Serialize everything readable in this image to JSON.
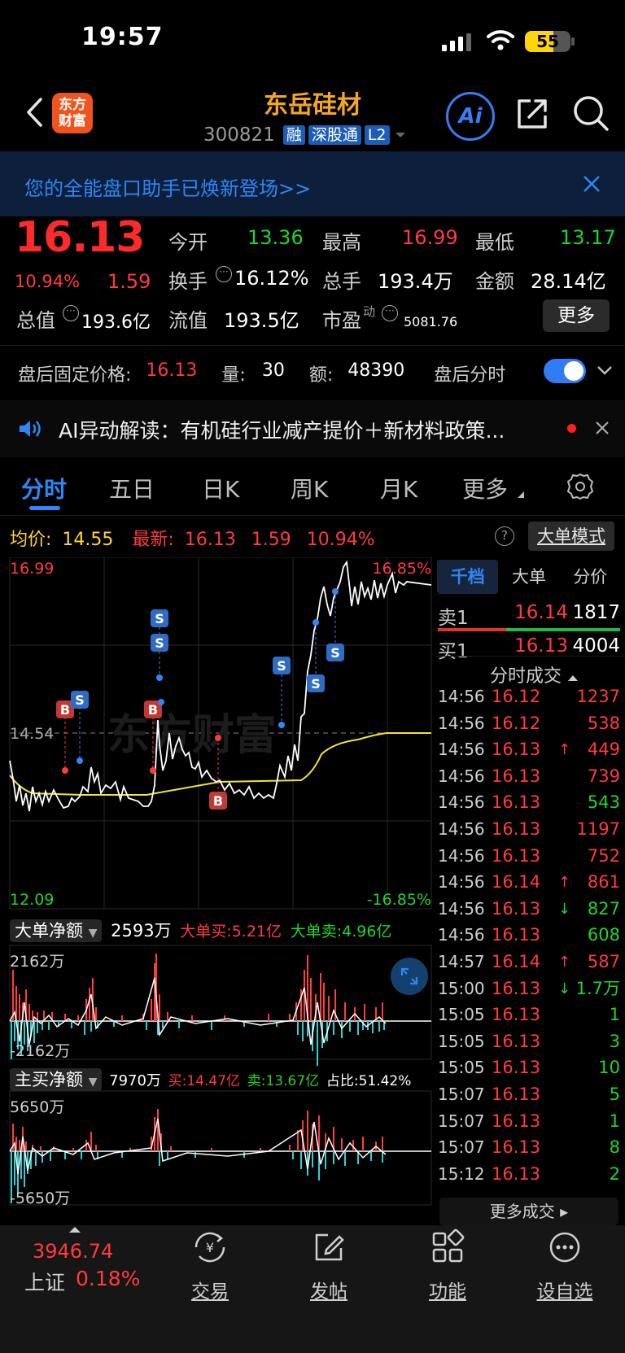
{
  "status_bar": {
    "time": "19:57",
    "battery": "55"
  },
  "header": {
    "logo_line1": "东方",
    "logo_line2": "财富",
    "stock_name": "东岳硅材",
    "stock_code": "300821",
    "tags": [
      "融",
      "深股通",
      "L2"
    ],
    "ai_label": "Ai"
  },
  "banner": {
    "text": "您的全能盘口助手已焕新登场>>"
  },
  "quote": {
    "price": "16.13",
    "change_pct": "10.94%",
    "change": "1.59",
    "open_label": "今开",
    "open": "13.36",
    "high_label": "最高",
    "high": "16.99",
    "low_label": "最低",
    "low": "13.17",
    "turnover_label": "换手",
    "turnover": "16.12%",
    "volume_label": "总手",
    "volume": "193.4万",
    "amount_label": "金额",
    "amount": "28.14亿",
    "mktcap_label": "总值",
    "mktcap": "193.6亿",
    "float_label": "流值",
    "float_cap": "193.5亿",
    "pe_label": "市盈",
    "pe_sup": "动",
    "pe": "5081.76",
    "more_button": "更多"
  },
  "after_hours": {
    "label": "盘后固定价格:",
    "price": "16.13",
    "vol_label": "量:",
    "vol": "30",
    "amt_label": "额:",
    "amt": "48390",
    "toggle_label": "盘后分时"
  },
  "ai_row": {
    "text": "AI异动解读：有机硅行业减产提价＋新材料政策..."
  },
  "tabs": [
    "分时",
    "五日",
    "日K",
    "周K",
    "月K",
    "更多"
  ],
  "info_bar": {
    "avg_label": "均价:",
    "avg": "14.55",
    "latest_label": "最新:",
    "latest": "16.13",
    "change": "1.59",
    "pct": "10.94%",
    "mode_button": "大单模式"
  },
  "main_chart": {
    "y_top": "16.99",
    "y_mid": "14.54",
    "y_bottom": "12.09",
    "pct_top": "16.85%",
    "pct_bottom": "-16.85%",
    "watermark": "东方财富"
  },
  "order_book": {
    "tabs": [
      "千档",
      "大单",
      "分价"
    ],
    "ask": {
      "label": "卖1",
      "price": "16.14",
      "vol": "1817"
    },
    "bid": {
      "label": "买1",
      "price": "16.13",
      "vol": "4004"
    }
  },
  "ticks": {
    "title": "分时成交",
    "rows": [
      {
        "t": "14:56",
        "p": "16.12",
        "d": "",
        "v": "1237",
        "c": "red"
      },
      {
        "t": "14:56",
        "p": "16.12",
        "d": "",
        "v": "538",
        "c": "red"
      },
      {
        "t": "14:56",
        "p": "16.13",
        "d": "↑",
        "v": "449",
        "c": "red"
      },
      {
        "t": "14:56",
        "p": "16.13",
        "d": "",
        "v": "739",
        "c": "red"
      },
      {
        "t": "14:56",
        "p": "16.13",
        "d": "",
        "v": "543",
        "c": "green"
      },
      {
        "t": "14:56",
        "p": "16.13",
        "d": "",
        "v": "1197",
        "c": "red"
      },
      {
        "t": "14:56",
        "p": "16.13",
        "d": "",
        "v": "752",
        "c": "red"
      },
      {
        "t": "14:56",
        "p": "16.14",
        "d": "↑",
        "v": "861",
        "c": "red"
      },
      {
        "t": "14:56",
        "p": "16.13",
        "d": "↓",
        "v": "827",
        "c": "green"
      },
      {
        "t": "14:56",
        "p": "16.13",
        "d": "",
        "v": "608",
        "c": "green"
      },
      {
        "t": "14:57",
        "p": "16.14",
        "d": "↑",
        "v": "587",
        "c": "red"
      },
      {
        "t": "15:00",
        "p": "16.13",
        "d": "↓",
        "v": "1.7万",
        "c": "green"
      },
      {
        "t": "15:05",
        "p": "16.13",
        "d": "",
        "v": "1",
        "c": "green"
      },
      {
        "t": "15:05",
        "p": "16.13",
        "d": "",
        "v": "3",
        "c": "green"
      },
      {
        "t": "15:05",
        "p": "16.13",
        "d": "",
        "v": "10",
        "c": "green"
      },
      {
        "t": "15:07",
        "p": "16.13",
        "d": "",
        "v": "5",
        "c": "green"
      },
      {
        "t": "15:07",
        "p": "16.13",
        "d": "",
        "v": "1",
        "c": "green"
      },
      {
        "t": "15:07",
        "p": "16.13",
        "d": "",
        "v": "8",
        "c": "green"
      },
      {
        "t": "15:12",
        "p": "16.13",
        "d": "",
        "v": "2",
        "c": "green"
      }
    ],
    "more": "更多成交"
  },
  "big_order": {
    "dropdown": "大单净额",
    "net": "2593万",
    "buy_label": "大单买:5.21亿",
    "sell_label": "大单卖:4.96亿",
    "y_top": "2162万",
    "y_bottom": "-2162万"
  },
  "main_buy": {
    "dropdown": "主买净额",
    "net": "7970万",
    "buy_label": "买:14.47亿",
    "sell_label": "卖:13.67亿",
    "ratio": "占比:51.42%",
    "y_top": "5650万",
    "y_bottom": "-5650万"
  },
  "bottom_nav": {
    "index_value": "3946.74",
    "index_name": "上证",
    "index_pct": "0.18%",
    "items": [
      "交易",
      "发帖",
      "功能",
      "设自选"
    ]
  },
  "colors": {
    "up": "#ff3b3b",
    "down": "#22d32a",
    "accent": "#2f7cf6",
    "brand": "#f5a623"
  }
}
